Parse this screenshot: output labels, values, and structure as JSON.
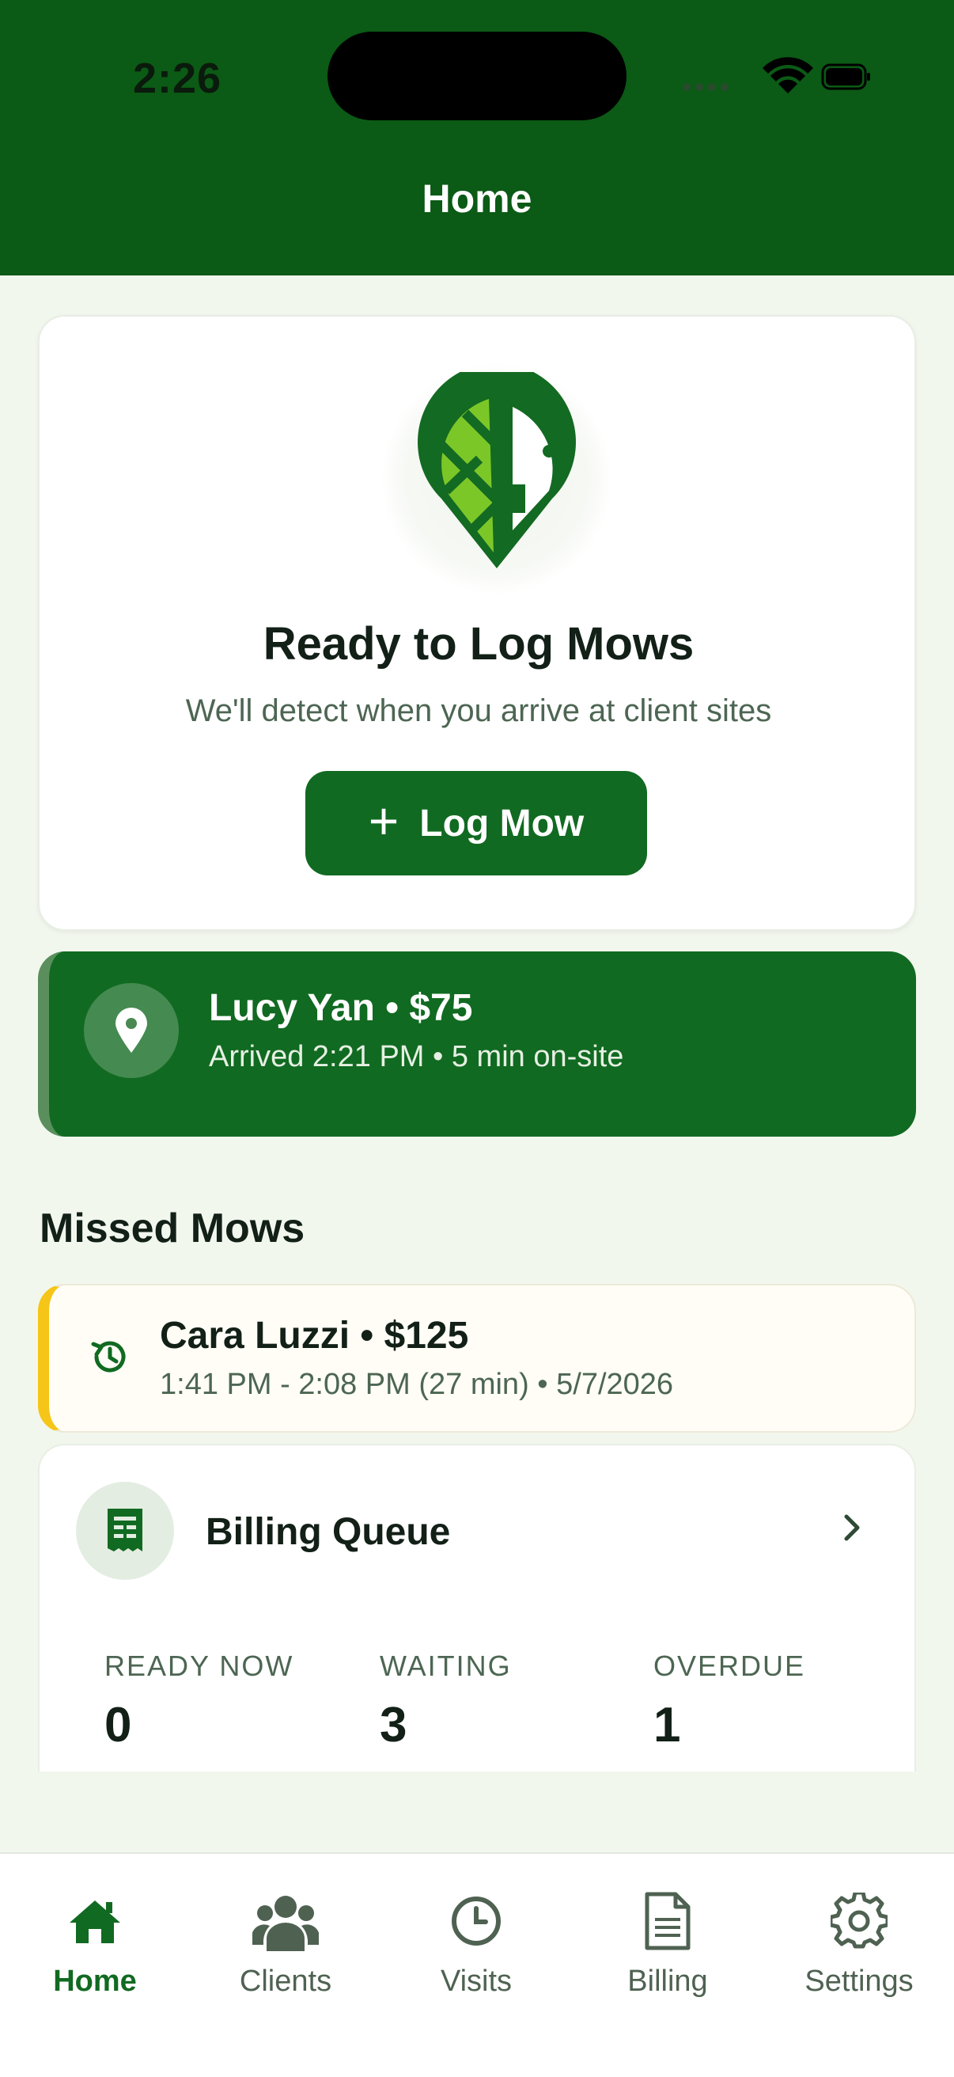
{
  "status_bar": {
    "time": "2:26"
  },
  "header": {
    "title": "Home"
  },
  "hero": {
    "title": "Ready to Log Mows",
    "subtitle": "We'll detect when you arrive at client sites",
    "button_icon": "+",
    "button_label": "Log Mow",
    "logo_icon": "leaf-pin-logo"
  },
  "active_visit": {
    "title": "Lucy Yan • $75",
    "subtitle": "Arrived 2:21 PM • 5 min on-site",
    "icon": "location-pin-icon"
  },
  "missed_section": {
    "title": "Missed Mows",
    "items": [
      {
        "title": "Cara Luzzi • $125",
        "subtitle": "1:41 PM - 2:08 PM (27 min) • 5/7/2026",
        "icon": "history-icon"
      }
    ]
  },
  "billing_queue": {
    "title": "Billing Queue",
    "icon": "receipt-icon",
    "stats": [
      {
        "label": "READY NOW",
        "value": "0"
      },
      {
        "label": "WAITING",
        "value": "3"
      },
      {
        "label": "OVERDUE",
        "value": "1"
      }
    ]
  },
  "tabs": [
    {
      "label": "Home",
      "icon": "home-icon",
      "active": true
    },
    {
      "label": "Clients",
      "icon": "users-icon",
      "active": false
    },
    {
      "label": "Visits",
      "icon": "clock-icon",
      "active": false
    },
    {
      "label": "Billing",
      "icon": "document-icon",
      "active": false
    },
    {
      "label": "Settings",
      "icon": "gear-icon",
      "active": false
    }
  ],
  "colors": {
    "brand_green": "#116a21",
    "header_green": "#0b5a15",
    "accent_yellow": "#f5c518",
    "background": "#f2f7ee"
  }
}
